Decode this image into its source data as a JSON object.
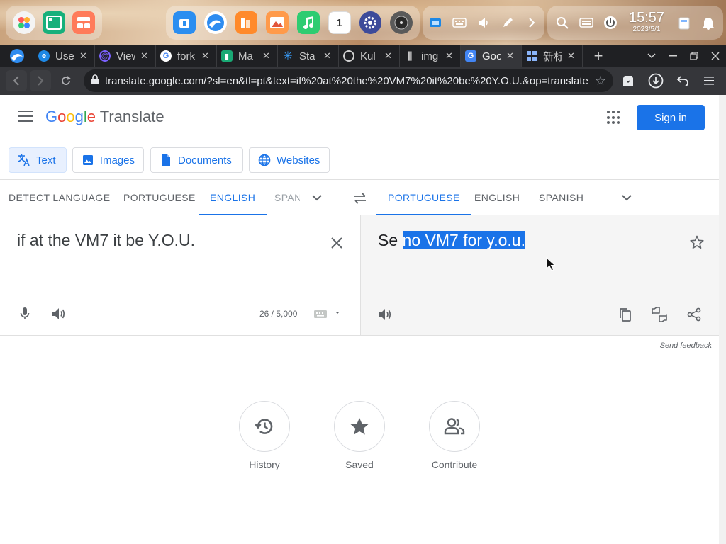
{
  "taskbar": {
    "left_apps": [
      {
        "icon": "launcher-icon",
        "color": "#f4f4f4"
      },
      {
        "icon": "terminal-icon",
        "color": "#17b07b"
      },
      {
        "icon": "app-grid-icon",
        "color": "#ff7b5a"
      }
    ],
    "center_apps": [
      {
        "icon": "app-store-icon",
        "color": "#2b8ef0"
      },
      {
        "icon": "browser-icon",
        "color": "#2e8cf0"
      },
      {
        "icon": "office-icon",
        "color": "#ff8a2b"
      },
      {
        "icon": "photos-icon",
        "color": "#ff9a4a"
      },
      {
        "icon": "music-icon",
        "color": "#2ecc71"
      },
      {
        "icon": "calendar-icon",
        "color": "#ffffff"
      },
      {
        "icon": "settings-icon",
        "color": "#3d4b9a"
      },
      {
        "icon": "disk-icon",
        "color": "#5a5a5a"
      }
    ],
    "calendar_day": "1",
    "time": "15:57",
    "date": "2023/5/1"
  },
  "browser": {
    "tabs": [
      {
        "title": "Use",
        "favicon": "edge-icon",
        "color": "#1e88e5",
        "active": false
      },
      {
        "title": "View",
        "favicon": "at-icon",
        "color": "#7b61ff",
        "active": false
      },
      {
        "title": "fork",
        "favicon": "google-g-icon",
        "color": "#ffffff",
        "active": false
      },
      {
        "title": "Ma",
        "favicon": "bars-icon",
        "color": "#19a974",
        "active": false
      },
      {
        "title": "Sta",
        "favicon": "asterisk-icon",
        "color": "#3aa0ff",
        "active": false
      },
      {
        "title": "Kul",
        "favicon": "globe-icon",
        "color": "#d0d0d0",
        "active": false
      },
      {
        "title": "img",
        "favicon": "columns-icon",
        "color": "#d0d0d0",
        "active": false
      },
      {
        "title": "Goo",
        "favicon": "google-translate-icon",
        "color": "#4285f4",
        "active": true
      },
      {
        "title": "新标",
        "favicon": "grid-icon",
        "color": "#8ab4f8",
        "active": false
      }
    ],
    "url": "translate.google.com/?sl=en&tl=pt&text=if%20at%20the%20VM7%20it%20be%20Y.O.U.&op=translate"
  },
  "gt": {
    "brand_google": "Google",
    "brand_product": "Translate",
    "sign_in": "Sign in",
    "modes": [
      {
        "label": "Text",
        "active": true
      },
      {
        "label": "Images",
        "active": false
      },
      {
        "label": "Documents",
        "active": false
      },
      {
        "label": "Websites",
        "active": false
      }
    ],
    "source_langs": [
      "DETECT LANGUAGE",
      "PORTUGUESE",
      "ENGLISH",
      "SPANISH"
    ],
    "source_active": "ENGLISH",
    "target_langs": [
      "PORTUGUESE",
      "ENGLISH",
      "SPANISH"
    ],
    "target_active": "PORTUGUESE",
    "source_text": "if at the VM7 it be Y.O.U.",
    "char_count": "26 / 5,000",
    "target_text_pre": "Se ",
    "target_text_selected": "no VM7 for y.o.u.",
    "send_feedback": "Send feedback",
    "bottom": [
      {
        "label": "History",
        "icon": "history-icon"
      },
      {
        "label": "Saved",
        "icon": "star-filled-icon"
      },
      {
        "label": "Contribute",
        "icon": "people-icon"
      }
    ]
  }
}
